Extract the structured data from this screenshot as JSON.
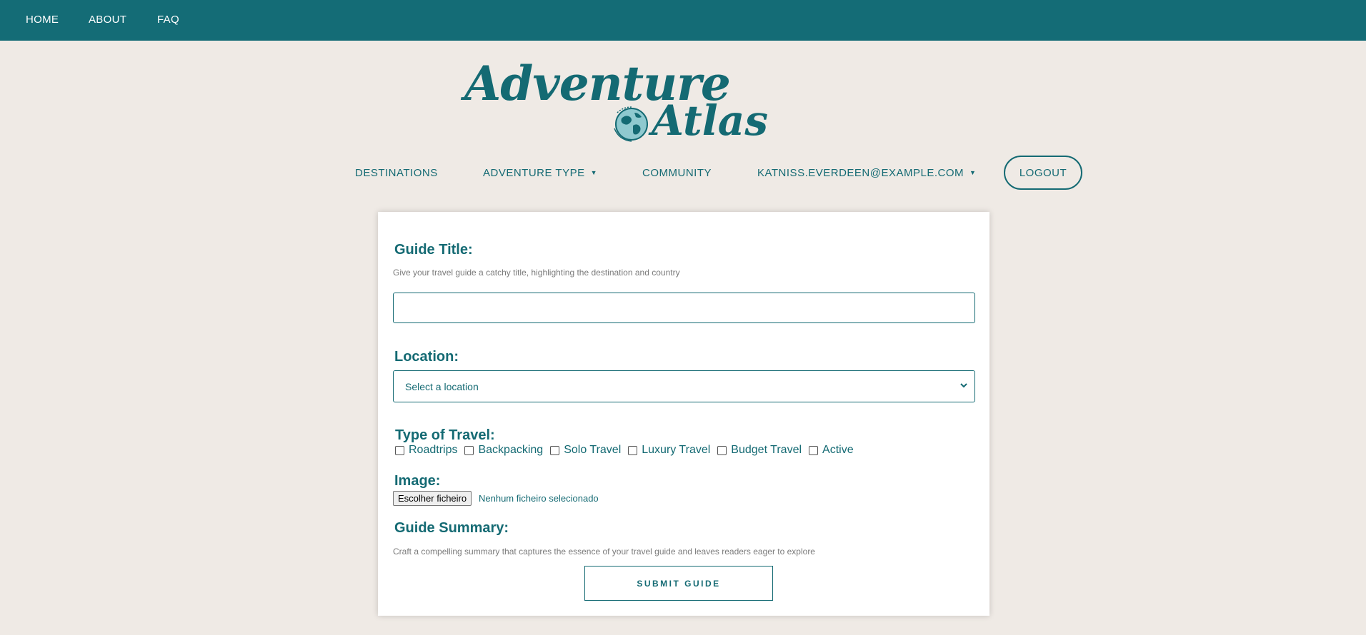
{
  "topnav": {
    "items": [
      {
        "label": "HOME"
      },
      {
        "label": "ABOUT"
      },
      {
        "label": "FAQ"
      }
    ]
  },
  "logo": {
    "line1": "Adventure",
    "line2": "Atlas",
    "icon": "globe-icon"
  },
  "mainnav": {
    "destinations": "DESTINATIONS",
    "adventure_type": "ADVENTURE TYPE",
    "community": "COMMUNITY",
    "user_email": "KATNISS.EVERDEEN@EXAMPLE.COM",
    "logout": "LOGOUT",
    "caret": "▼"
  },
  "form": {
    "guide_title_label": "Guide Title:",
    "guide_title_help": "Give your travel guide a catchy title, highlighting the destination and country",
    "guide_title_value": "",
    "location_label": "Location:",
    "location_selected": "Select a location",
    "travel_type_label": "Type of Travel:",
    "travel_types": [
      {
        "label": "Roadtrips",
        "checked": false
      },
      {
        "label": "Backpacking",
        "checked": false
      },
      {
        "label": "Solo Travel",
        "checked": false
      },
      {
        "label": "Luxury Travel",
        "checked": false
      },
      {
        "label": "Budget Travel",
        "checked": false
      },
      {
        "label": "Active",
        "checked": false
      }
    ],
    "image_label": "Image:",
    "file_button": "Escolher ficheiro",
    "file_status": "Nenhum ficheiro selecionado",
    "summary_label": "Guide Summary:",
    "summary_help": "Craft a compelling summary that captures the essence of your travel guide and leaves readers eager to explore",
    "submit_label": "SUBMIT GUIDE"
  },
  "colors": {
    "brand": "#146c76",
    "background": "#efeae5",
    "card": "#ffffff"
  }
}
